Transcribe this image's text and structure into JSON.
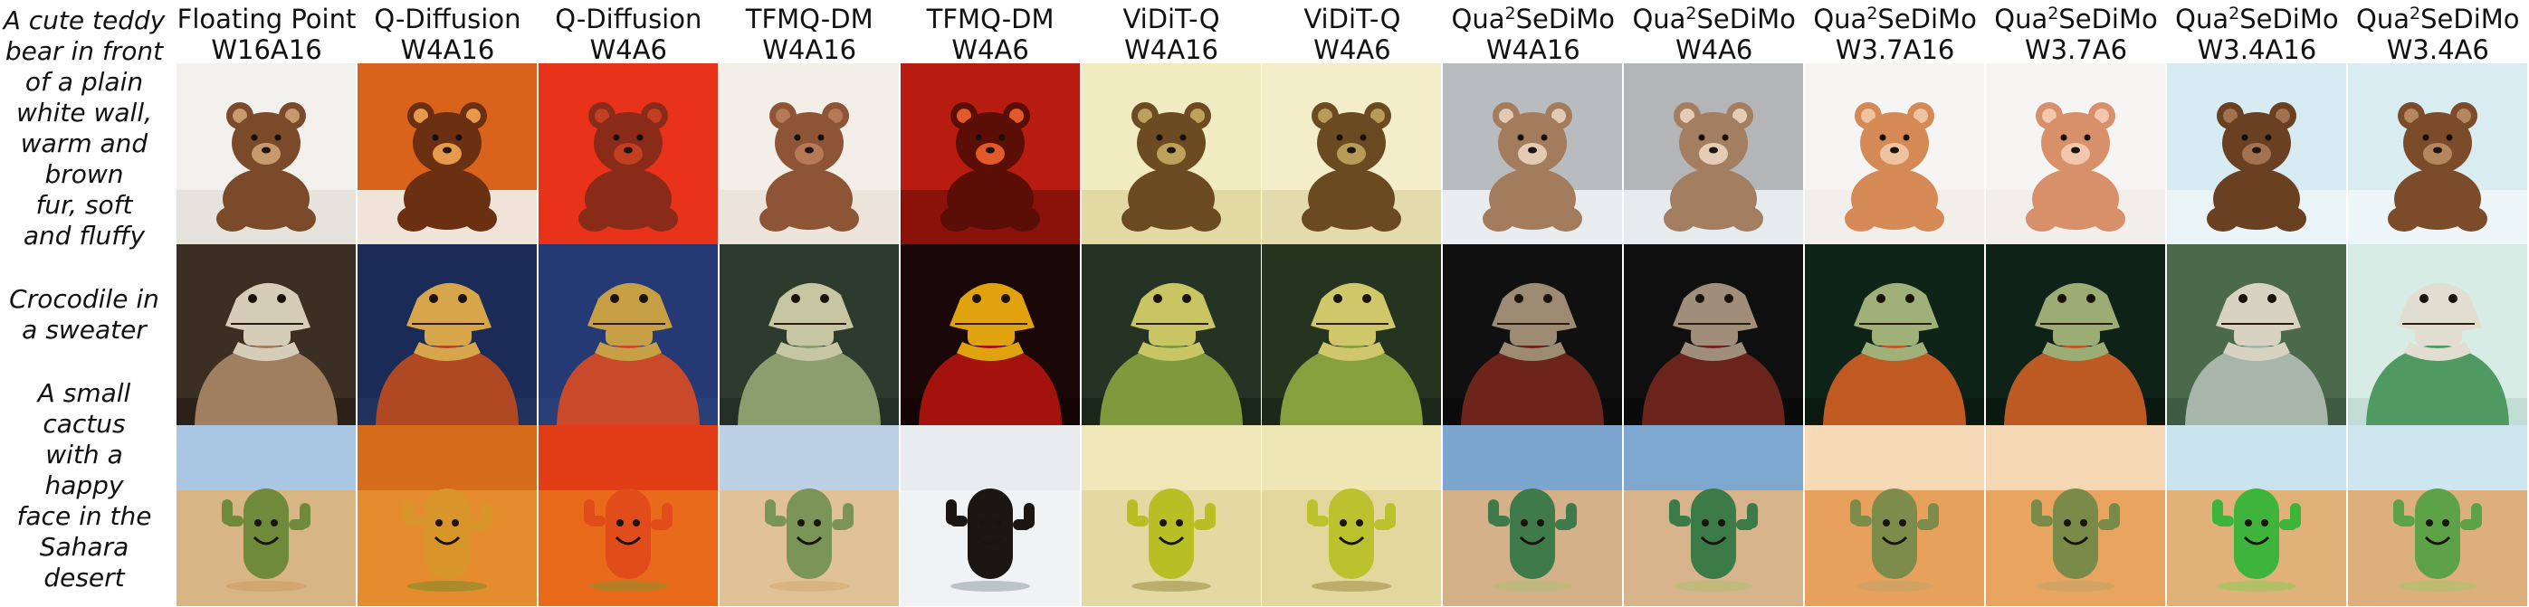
{
  "columns": [
    {
      "line1": "Floating Point",
      "line2": "W16A16"
    },
    {
      "line1": "Q-Diffusion",
      "line2": "W4A16"
    },
    {
      "line1": "Q-Diffusion",
      "line2": "W4A6"
    },
    {
      "line1": "TFMQ-DM",
      "line2": "W4A16"
    },
    {
      "line1": "TFMQ-DM",
      "line2": "W4A6"
    },
    {
      "line1": "ViDiT-Q",
      "line2": "W4A16"
    },
    {
      "line1": "ViDiT-Q",
      "line2": "W4A6"
    },
    {
      "line1": "Qua²SeDiMo",
      "line2": "W4A16"
    },
    {
      "line1": "Qua²SeDiMo",
      "line2": "W4A6"
    },
    {
      "line1": "Qua²SeDiMo",
      "line2": "W3.7A16"
    },
    {
      "line1": "Qua²SeDiMo",
      "line2": "W3.7A6"
    },
    {
      "line1": "Qua²SeDiMo",
      "line2": "W3.4A16"
    },
    {
      "line1": "Qua²SeDiMo",
      "line2": "W3.4A6"
    }
  ],
  "rows": [
    {
      "subject": "teddy",
      "prompt": [
        "A cute teddy",
        "bear in front",
        "of a plain",
        "white wall,",
        "warm and",
        "brown",
        "fur, soft",
        "and fluffy"
      ]
    },
    {
      "subject": "crocodile",
      "prompt": [
        "Crocodile in",
        "a sweater"
      ]
    },
    {
      "subject": "cactus",
      "prompt": [
        "A small",
        "cactus",
        "with a",
        "happy",
        "face in the",
        "Sahara",
        "desert"
      ]
    }
  ],
  "tile_palettes": [
    [
      {
        "bg": "#f2f0ed",
        "floor": "#e6e2dc",
        "fg": "#7a4a2a",
        "accent": "#c79a6d"
      },
      {
        "bg": "#d9631a",
        "floor": "#f0e4d8",
        "fg": "#6b2f12",
        "accent": "#e79a4b"
      },
      {
        "bg": "#e8321a",
        "floor": "#e8321a",
        "fg": "#8a2a18",
        "accent": "#c23f22"
      },
      {
        "bg": "#f4eee8",
        "floor": "#ece4da",
        "fg": "#8d5436",
        "accent": "#b77a58"
      },
      {
        "bg": "#b81c10",
        "floor": "#8a1208",
        "fg": "#5a0e06",
        "accent": "#e25a2a"
      },
      {
        "bg": "#f1ebc2",
        "floor": "#e3d9a2",
        "fg": "#6d4b22",
        "accent": "#bca25a"
      },
      {
        "bg": "#f3eec9",
        "floor": "#e3dbab",
        "fg": "#6b4a22",
        "accent": "#b79b56"
      },
      {
        "bg": "#b9bcbe",
        "floor": "#e9edf0",
        "fg": "#a27c5d",
        "accent": "#e2cbb2"
      },
      {
        "bg": "#b3b5b7",
        "floor": "#e6ebee",
        "fg": "#a37e60",
        "accent": "#e4cdb5"
      },
      {
        "bg": "#f6f5f4",
        "floor": "#f2eeea",
        "fg": "#d58a55",
        "accent": "#f0c3a0"
      },
      {
        "bg": "#f6f5f4",
        "floor": "#f2eeea",
        "fg": "#d8906b",
        "accent": "#f2c7ad"
      },
      {
        "bg": "#d7ebf3",
        "floor": "#eaf4f7",
        "fg": "#6a4023",
        "accent": "#a37250"
      },
      {
        "bg": "#d9ecf2",
        "floor": "#edf6f8",
        "fg": "#7c4c2a",
        "accent": "#b5875f"
      }
    ],
    [
      {
        "bg": "#3b2e22",
        "floor": "#2b2119",
        "fg": "#9f7f5f",
        "accent": "#d6cdb8"
      },
      {
        "bg": "#1b2b57",
        "floor": "#20335f",
        "fg": "#b04824",
        "accent": "#d7a64a"
      },
      {
        "bg": "#253a74",
        "floor": "#2a3f78",
        "fg": "#c84a2a",
        "accent": "#c7a045"
      },
      {
        "bg": "#2d3b2f",
        "floor": "#243025",
        "fg": "#8c9d6e",
        "accent": "#c7c6a2"
      },
      {
        "bg": "#1a0707",
        "floor": "#140404",
        "fg": "#a3120c",
        "accent": "#e0a30f"
      },
      {
        "bg": "#243323",
        "floor": "#1b261b",
        "fg": "#7f9a3c",
        "accent": "#c9c464"
      },
      {
        "bg": "#25341f",
        "floor": "#1c281a",
        "fg": "#86a03e",
        "accent": "#cfc76a"
      },
      {
        "bg": "#111010",
        "floor": "#0c0b0b",
        "fg": "#6d241a",
        "accent": "#9c8a73"
      },
      {
        "bg": "#0f0f0f",
        "floor": "#0a0a0a",
        "fg": "#6a241c",
        "accent": "#a08e7b"
      },
      {
        "bg": "#0f2418",
        "floor": "#0a1a10",
        "fg": "#c05a22",
        "accent": "#9fb079"
      },
      {
        "bg": "#0e2217",
        "floor": "#0a190f",
        "fg": "#bd5a24",
        "accent": "#9cac75"
      },
      {
        "bg": "#4b6a4c",
        "floor": "#3e5a41",
        "fg": "#a8b6aa",
        "accent": "#d8d2c3"
      },
      {
        "bg": "#d7ece5",
        "floor": "#c2ddd3",
        "fg": "#4f9a62",
        "accent": "#e1ddd0"
      }
    ],
    [
      {
        "bg": "#a9c6e2",
        "floor": "#d8b584",
        "fg": "#6e8a3a",
        "accent": "#c99457"
      },
      {
        "bg": "#d76b1c",
        "floor": "#e58d2e",
        "fg": "#d8962a",
        "accent": "#5f8a2a"
      },
      {
        "bg": "#e23d16",
        "floor": "#ea6a1c",
        "fg": "#e04c1a",
        "accent": "#7c9a32"
      },
      {
        "bg": "#bcd1e6",
        "floor": "#e1c296",
        "fg": "#7b9457",
        "accent": "#cfa46a"
      },
      {
        "bg": "#e8ecef",
        "floor": "#f0f2f3",
        "fg": "#1b1612",
        "accent": "#7a8a8e"
      },
      {
        "bg": "#f0e8b8",
        "floor": "#e4d9a2",
        "fg": "#b7bf24",
        "accent": "#8a7a2c"
      },
      {
        "bg": "#efe6b5",
        "floor": "#e3d79e",
        "fg": "#bcc12e",
        "accent": "#8c7b2b"
      },
      {
        "bg": "#7ca6cf",
        "floor": "#d5b18a",
        "fg": "#3f7a4a",
        "accent": "#a7c46e"
      },
      {
        "bg": "#7ea7cf",
        "floor": "#d8b48c",
        "fg": "#3c7a48",
        "accent": "#a3c06b"
      },
      {
        "bg": "#f6d9b6",
        "floor": "#e8a15c",
        "fg": "#7d8c4a",
        "accent": "#b7a36a"
      },
      {
        "bg": "#f4d7b4",
        "floor": "#e9a45f",
        "fg": "#7a8a48",
        "accent": "#b5a168"
      },
      {
        "bg": "#c9e4ef",
        "floor": "#e0b27a",
        "fg": "#3fb43d",
        "accent": "#78d14f"
      },
      {
        "bg": "#cde6ef",
        "floor": "#ddb07b",
        "fg": "#5ea247",
        "accent": "#95c86b"
      }
    ]
  ]
}
